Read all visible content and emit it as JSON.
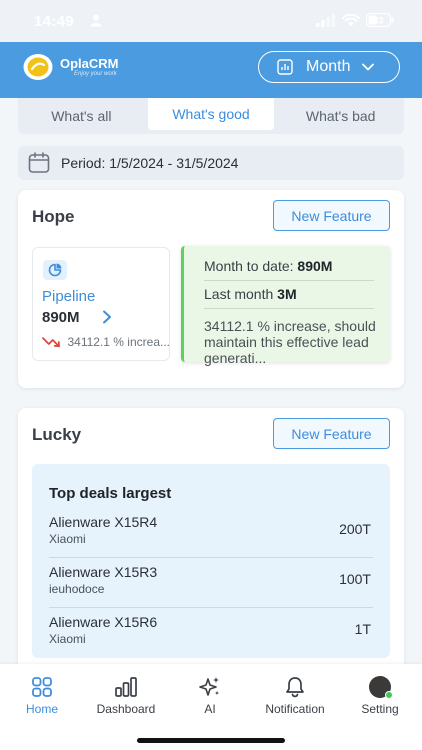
{
  "status_bar": {
    "time": "14:49",
    "battery": "33"
  },
  "header": {
    "brand_name": "OplaCRM",
    "brand_tagline": "Enjoy your work",
    "period_selector": "Month"
  },
  "tabs": [
    {
      "label": "What's all"
    },
    {
      "label": "What's good"
    },
    {
      "label": "What's bad"
    }
  ],
  "period": {
    "label": "Period:",
    "range": "1/5/2024 - 31/5/2024"
  },
  "hope_card": {
    "title": "Hope",
    "button": "New Feature",
    "pipeline": {
      "label": "Pipeline",
      "value": "890M",
      "trend_text": "34112.1 % increa..."
    },
    "popup": {
      "mtd_label": "Month to date:",
      "mtd_value": "890M",
      "last_label": "Last month",
      "last_value": "3M",
      "note": "34112.1 % increase, should maintain this effective lead generati..."
    }
  },
  "lucky_card": {
    "title": "Lucky",
    "button": "New Feature",
    "deals_title": "Top deals largest",
    "deals": [
      {
        "name": "Alienware X15R4",
        "company": "Xiaomi",
        "value": "200T"
      },
      {
        "name": "Alienware X15R3",
        "company": "ieuhodoce",
        "value": "100T"
      },
      {
        "name": "Alienware X15R6",
        "company": "Xiaomi",
        "value": "1T"
      }
    ]
  },
  "bottom_nav": [
    {
      "label": "Home",
      "icon": "grid-icon"
    },
    {
      "label": "Dashboard",
      "icon": "bar-chart-icon"
    },
    {
      "label": "AI",
      "icon": "sparkle-icon"
    },
    {
      "label": "Notification",
      "icon": "bell-icon"
    },
    {
      "label": "Setting",
      "icon": "avatar"
    }
  ],
  "colors": {
    "brand_blue": "#4a9be0",
    "accent_blue": "#3d8ddc",
    "positive_green": "#5fd05a",
    "trend_red": "#e0443a"
  }
}
